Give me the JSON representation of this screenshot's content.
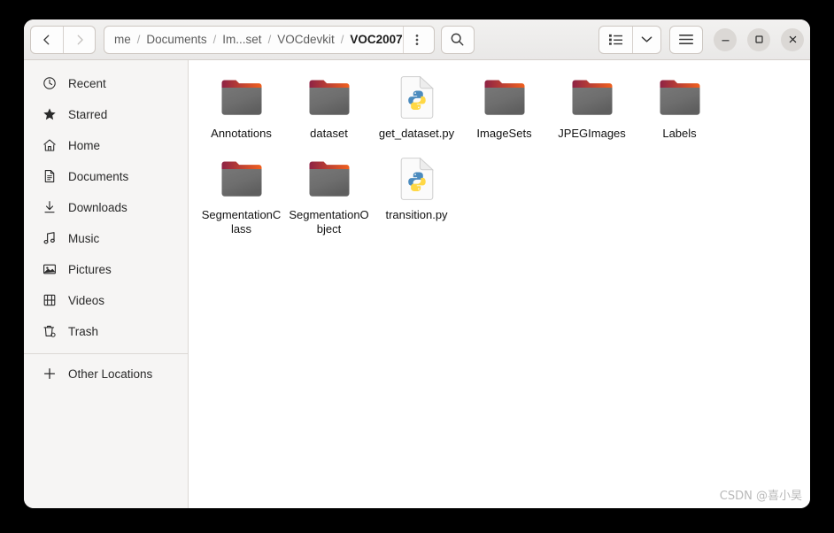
{
  "window": {
    "controls": {
      "minimize_label": "Minimize",
      "maximize_label": "Maximize",
      "close_label": "Close"
    }
  },
  "header": {
    "nav": {
      "back_label": "Back",
      "forward_label": "Forward"
    },
    "pathbar": {
      "crumbs": [
        {
          "label": "me",
          "current": false
        },
        {
          "label": "Documents",
          "current": false
        },
        {
          "label": "Im...set",
          "current": false
        },
        {
          "label": "VOCdevkit",
          "current": false
        },
        {
          "label": "VOC2007",
          "current": true
        }
      ],
      "separator": "/",
      "kebab_label": "Path options"
    },
    "search_label": "Search",
    "view_list_label": "List view",
    "view_options_label": "View options",
    "menu_label": "Main menu"
  },
  "sidebar": {
    "items": [
      {
        "label": "Recent",
        "icon": "clock-icon"
      },
      {
        "label": "Starred",
        "icon": "star-icon"
      },
      {
        "label": "Home",
        "icon": "home-icon"
      },
      {
        "label": "Documents",
        "icon": "document-icon"
      },
      {
        "label": "Downloads",
        "icon": "download-icon"
      },
      {
        "label": "Music",
        "icon": "music-icon"
      },
      {
        "label": "Pictures",
        "icon": "picture-icon"
      },
      {
        "label": "Videos",
        "icon": "video-icon"
      },
      {
        "label": "Trash",
        "icon": "trash-icon"
      }
    ],
    "other": {
      "label": "Other Locations",
      "icon": "plus-icon"
    }
  },
  "files": [
    {
      "name": "Annotations",
      "type": "folder"
    },
    {
      "name": "dataset",
      "type": "folder"
    },
    {
      "name": "get_dataset.py",
      "type": "python"
    },
    {
      "name": "ImageSets",
      "type": "folder"
    },
    {
      "name": "JPEGImages",
      "type": "folder"
    },
    {
      "name": "Labels",
      "type": "folder"
    },
    {
      "name": "SegmentationClass",
      "type": "folder"
    },
    {
      "name": "SegmentationObject",
      "type": "folder"
    },
    {
      "name": "transition.py",
      "type": "python"
    }
  ],
  "watermark": {
    "text": "CSDN @喜小昊"
  },
  "colors": {
    "folder_tab_start": "#8e2345",
    "folder_tab_end": "#f0601e",
    "folder_body": "#6e6e6e",
    "python_blue": "#4b8bbe",
    "python_yellow": "#ffd845",
    "headerbar": "#eceaE8",
    "sidebar_bg": "#f6f5f4",
    "content_bg": "#ffffff"
  }
}
